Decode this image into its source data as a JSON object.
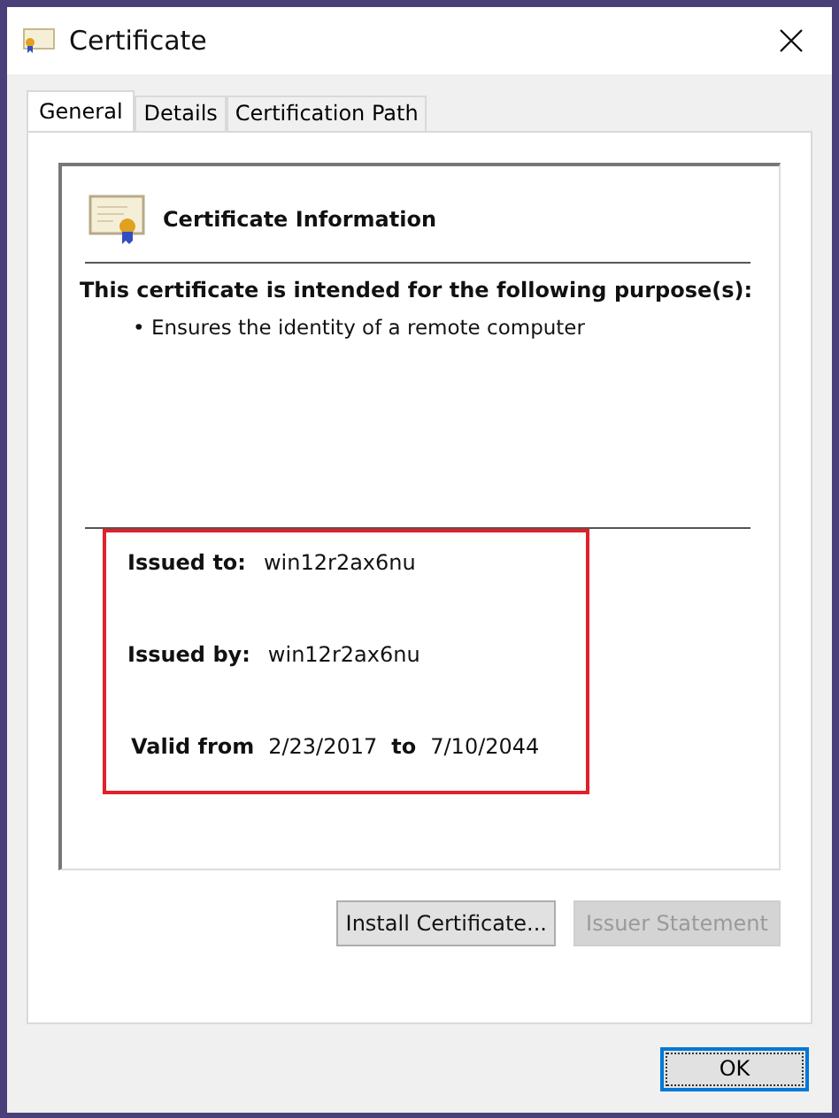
{
  "window": {
    "title": "Certificate"
  },
  "tabs": [
    {
      "label": "General",
      "selected": true
    },
    {
      "label": "Details",
      "selected": false
    },
    {
      "label": "Certification Path",
      "selected": false
    }
  ],
  "info": {
    "heading": "Certificate Information",
    "purpose_title": "This certificate is intended for the following purpose(s):",
    "purposes": [
      "• Ensures the identity of a remote computer"
    ],
    "issued_to_label": "Issued to:",
    "issued_to": "win12r2ax6nu",
    "issued_by_label": "Issued by:",
    "issued_by": "win12r2ax6nu",
    "valid_from_label": "Valid from",
    "valid_from": "2/23/2017",
    "to_label": "to",
    "valid_to": "7/10/2044"
  },
  "buttons": [
    {
      "label": "Install Certificate...",
      "disabled": false
    },
    {
      "label": "Issuer Statement",
      "disabled": true
    }
  ],
  "ok_button": "OK"
}
